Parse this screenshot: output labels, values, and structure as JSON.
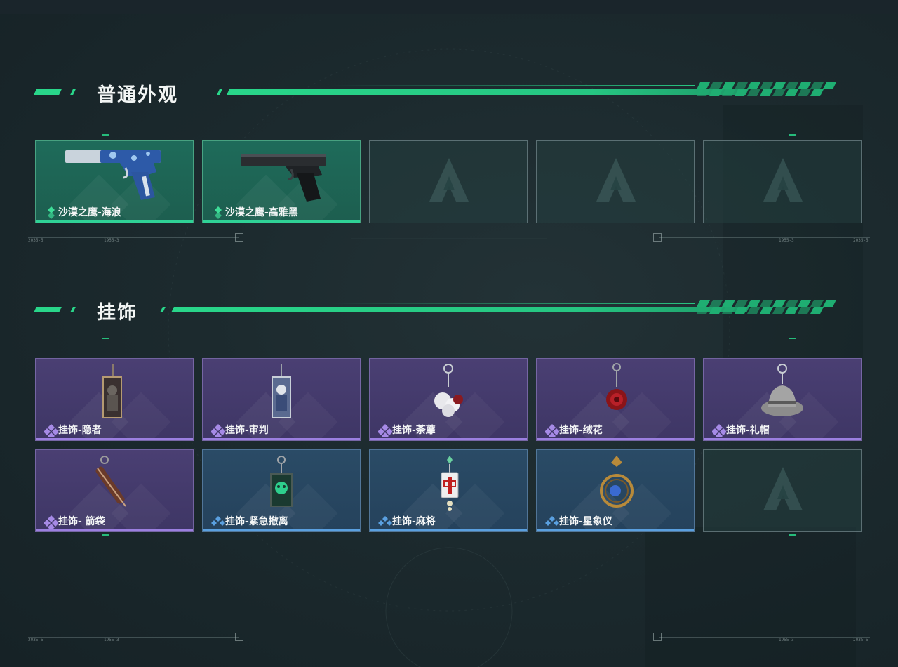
{
  "sections": [
    {
      "title": "普通外观",
      "items": [
        {
          "label": "沙漠之鹰-海浪",
          "rarity": "green",
          "icon": "blue-pistol-icon"
        },
        {
          "label": "沙漠之鹰-高雅黑",
          "rarity": "green",
          "icon": "black-pistol-icon"
        },
        {
          "label": "",
          "rarity": "empty"
        },
        {
          "label": "",
          "rarity": "empty"
        },
        {
          "label": "",
          "rarity": "empty"
        }
      ]
    },
    {
      "title": "挂饰",
      "items": [
        {
          "label": "挂饰-隐者",
          "rarity": "purple",
          "icon": "tarot-card-charm-icon"
        },
        {
          "label": "挂饰-审判",
          "rarity": "purple",
          "icon": "tarot-card-charm-icon"
        },
        {
          "label": "挂饰-荼蘼",
          "rarity": "purple",
          "icon": "white-flower-charm-icon"
        },
        {
          "label": "挂饰-绒花",
          "rarity": "purple",
          "icon": "red-rose-charm-icon"
        },
        {
          "label": "挂饰-礼帽",
          "rarity": "purple",
          "icon": "fedora-hat-charm-icon"
        },
        {
          "label": "挂饰- 箭袋",
          "rarity": "purple",
          "icon": "quiver-charm-icon"
        },
        {
          "label": "挂饰-紧急撤离",
          "rarity": "blue",
          "icon": "green-skull-charm-icon"
        },
        {
          "label": "挂饰-麻将",
          "rarity": "blue",
          "icon": "mahjong-tile-charm-icon"
        },
        {
          "label": "挂饰-星象仪",
          "rarity": "blue",
          "icon": "astrolabe-charm-icon"
        },
        {
          "label": "",
          "rarity": "empty"
        }
      ]
    }
  ],
  "decor_text": [
    "2035-5",
    "1955-3"
  ],
  "colors": {
    "accent": "#29d68a",
    "green_rarity": "#2fd296",
    "purple_rarity": "#9b7fe0",
    "blue_rarity": "#5aa0e0"
  }
}
